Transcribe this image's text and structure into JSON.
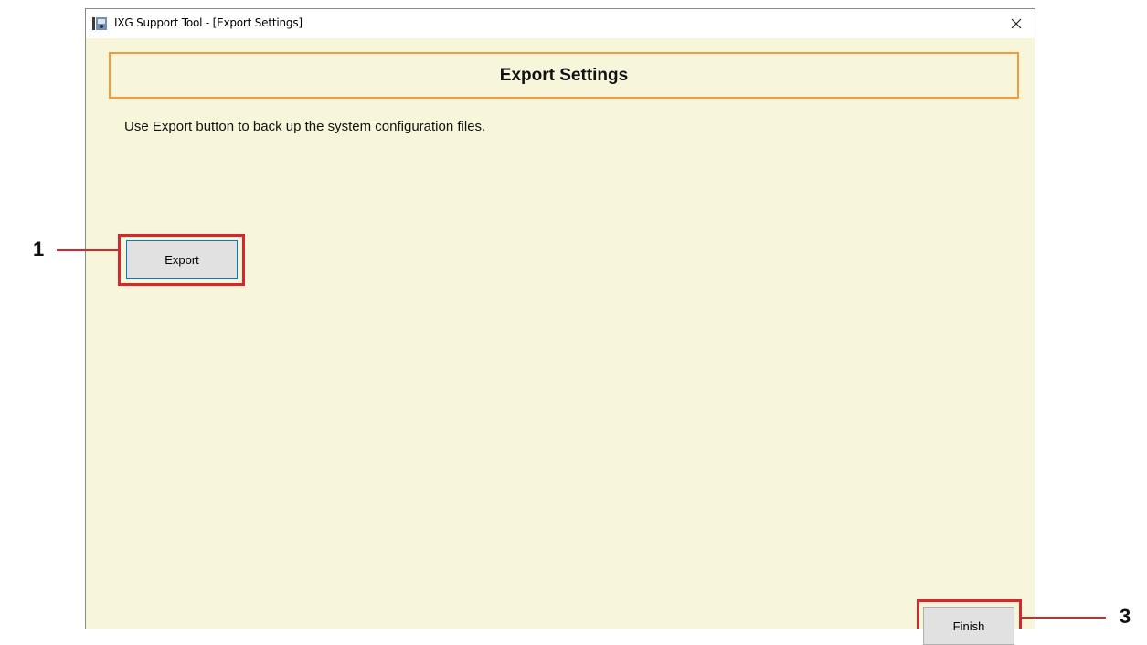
{
  "window": {
    "title": "IXG Support Tool - [Export Settings]",
    "close_glyph": "✕"
  },
  "header": {
    "title": "Export Settings"
  },
  "description": "Use Export button to back up the system configuration files.",
  "buttons": {
    "export_label": "Export",
    "finish_label": "Finish"
  },
  "callouts": {
    "export_number": "1",
    "finish_number": "3"
  },
  "colors": {
    "panel_background": "#f7f6da",
    "header_border": "#f39a3a",
    "callout_red": "#d8262d",
    "focus_border": "#0078d7"
  }
}
